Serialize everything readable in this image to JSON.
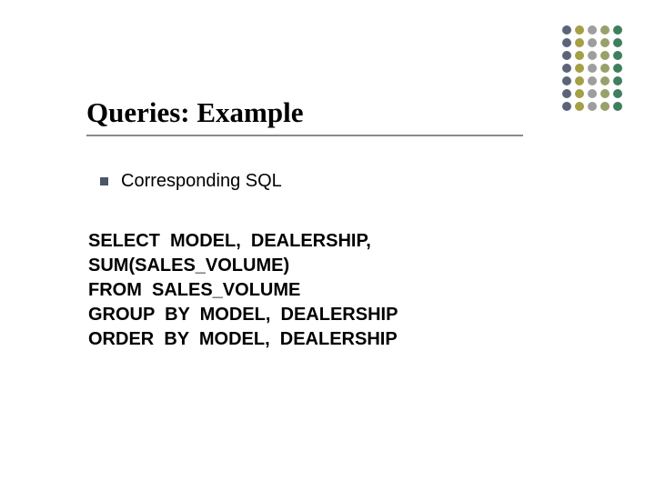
{
  "title": "Queries: Example",
  "bullet_text": "Corresponding SQL",
  "sql": "SELECT  MODEL,  DEALERSHIP,\nSUM(SALES_VOLUME)\nFROM  SALES_VOLUME\nGROUP  BY  MODEL,  DEALERSHIP\nORDER  BY  MODEL,  DEALERSHIP",
  "decor_colors": {
    "col1": "#5b6478",
    "col2": "#a59f46",
    "col3": "#9e9e9e",
    "col4": "#9aa06a",
    "col5": "#3f7f5f"
  }
}
